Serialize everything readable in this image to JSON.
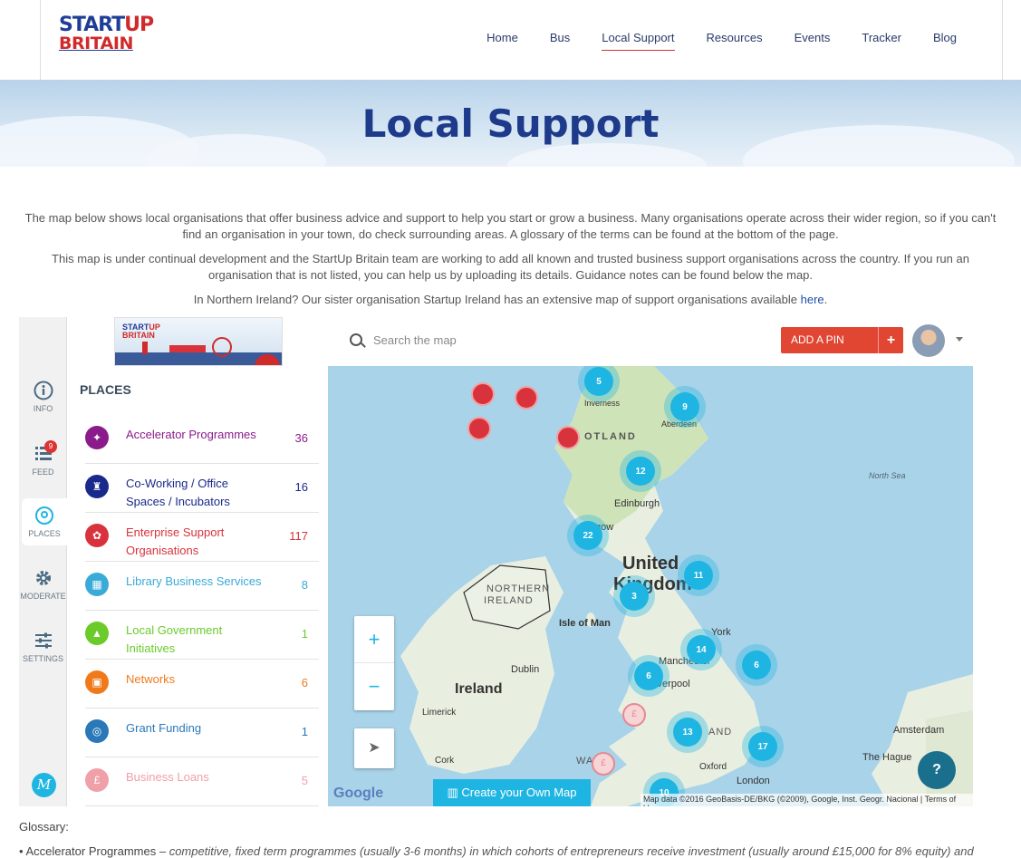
{
  "header": {
    "logo_top": "START",
    "logo_up": "UP",
    "logo_bottom": "BRITAIN",
    "nav": [
      "Home",
      "Bus",
      "Local Support",
      "Resources",
      "Events",
      "Tracker",
      "Blog"
    ],
    "active_nav": "Local Support"
  },
  "hero": {
    "title": "Local Support"
  },
  "intro": {
    "p1": "The map below shows local organisations that offer business advice and support to help you start or grow a business. Many organisations operate across their wider region, so if you can't find an organisation in your town, do check surrounding areas. A glossary of the terms can be found at the bottom of the page.",
    "p2": "This map is under continual development and the StartUp Britain team are working to add all known and trusted business support organisations across the country. If you run an organisation that is not listed, you can help us by uploading its details. Guidance notes can be found below the map.",
    "p3": "In Northern Ireland? Our sister organisation Startup Ireland has an extensive map of support organisations available ",
    "p3_link": "here",
    "p3_end": "."
  },
  "sidebar": {
    "items": [
      {
        "label": "INFO",
        "icon": "info-icon"
      },
      {
        "label": "FEED",
        "icon": "feed-icon",
        "badge": "9"
      },
      {
        "label": "PLACES",
        "icon": "location-icon"
      },
      {
        "label": "MODERATE",
        "icon": "gear-icon"
      },
      {
        "label": "SETTINGS",
        "icon": "sliders-icon"
      }
    ],
    "brand_letter": "M"
  },
  "thumb": {
    "line1": "START",
    "line1_up": "UP",
    "line2": "BRITAIN"
  },
  "panel": {
    "title": "PLACES",
    "categories": [
      {
        "name": "Accelerator Programmes",
        "count": "36",
        "color": "#8b1a8b"
      },
      {
        "name": "Co-Working / Office Spaces / Incubators",
        "count": "16",
        "color": "#1a2a8b"
      },
      {
        "name": "Enterprise Support Organisations",
        "count": "117",
        "color": "#d8333d"
      },
      {
        "name": "Library Business Services",
        "count": "8",
        "color": "#3aaad8"
      },
      {
        "name": "Local Government Initiatives",
        "count": "1",
        "color": "#6acb2a"
      },
      {
        "name": "Networks",
        "count": "6",
        "color": "#f07a1a"
      },
      {
        "name": "Grant Funding",
        "count": "1",
        "color": "#2a78b8"
      },
      {
        "name": "Business Loans",
        "count": "5",
        "color": "#f0a0a8"
      }
    ]
  },
  "toolbar": {
    "search_placeholder": "Search the map",
    "add_pin_label": "ADD A PIN",
    "add_pin_plus": "+"
  },
  "map": {
    "labels": {
      "inverness": "Inverness",
      "aberdeen": "Aberdeen",
      "scotland": "OTLAND",
      "edinburgh": "Edinburgh",
      "glasgow": "gow",
      "north_sea": "North Sea",
      "united": "United",
      "kingdom": "Kingdom",
      "northern_ireland_1": "NORTHERN",
      "northern_ireland_2": "IRELAND",
      "isle_of_man": "Isle of Man",
      "york": "York",
      "ireland": "Ireland",
      "dublin": "Dublin",
      "manchester": "Manchester",
      "liverpool": "Liverpool",
      "limerick": "Limerick",
      "cork": "Cork",
      "oxford": "Oxford",
      "london": "London",
      "amsterdam": "Amsterdam",
      "hague": "The Hague",
      "wales": "WA",
      "england": "AND"
    },
    "clusters": [
      "5",
      "9",
      "12",
      "22",
      "11",
      "3",
      "14",
      "6",
      "6",
      "13",
      "17",
      "10"
    ],
    "zoom_in": "+",
    "zoom_out": "−",
    "create_label": "Create your Own Map",
    "google": "Google",
    "attribution": "Map data ©2016 GeoBasis-DE/BKG (©2009), Google, Inst. Geogr. Nacional",
    "terms": "Terms of Use"
  },
  "glossary": {
    "title": "Glossary:",
    "item1_term": "Accelerator Programmes –",
    "item1_desc": "competitive, fixed term programmes (usually 3-6 months) in which cohorts of entrepreneurs receive investment (usually around £15,000 for 8% equity) and"
  },
  "colors": {
    "brand_blue": "#1e3a8a",
    "brand_red": "#d12a2a",
    "cluster": "#1fb5e3",
    "add_pin": "#e04632"
  }
}
